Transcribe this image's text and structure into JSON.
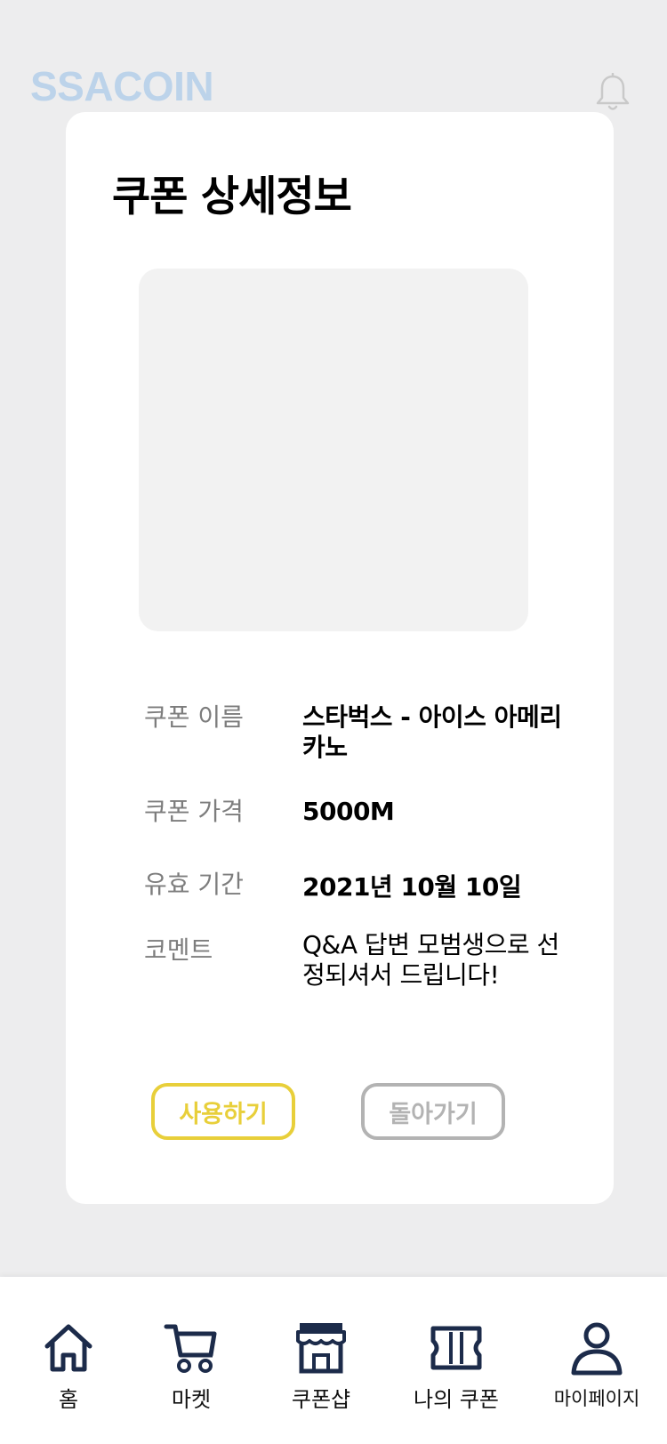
{
  "header": {
    "logo": "SSACOIN",
    "bell_icon": "bell-icon"
  },
  "modal": {
    "title": "쿠폰 상세정보",
    "details": [
      {
        "label": "쿠폰 이름",
        "value": "스타벅스 - 아이스 아메리카노"
      },
      {
        "label": "쿠폰 가격",
        "value": "5000M"
      },
      {
        "label": "유효 기간",
        "value": "2021년 10월 10일"
      },
      {
        "label": "코멘트",
        "value": "Q&A 답변 모범생으로 선정되셔서 드립니다!"
      }
    ],
    "use_button": "사용하기",
    "back_button": "돌아가기"
  },
  "nav": {
    "items": [
      {
        "label": "홈",
        "icon": "home-icon"
      },
      {
        "label": "마켓",
        "icon": "cart-icon"
      },
      {
        "label": "쿠폰샵",
        "icon": "store-icon"
      },
      {
        "label": "나의 쿠폰",
        "icon": "ticket-icon"
      },
      {
        "label": "마이페이지",
        "icon": "user-icon"
      }
    ]
  },
  "colors": {
    "background": "#ededee",
    "logo": "#bcd3ea",
    "use_button": "#e8cf3a",
    "back_button": "#b3b3b3",
    "nav_icon": "#1c2b4a",
    "label_gray": "#7d7d7d"
  }
}
